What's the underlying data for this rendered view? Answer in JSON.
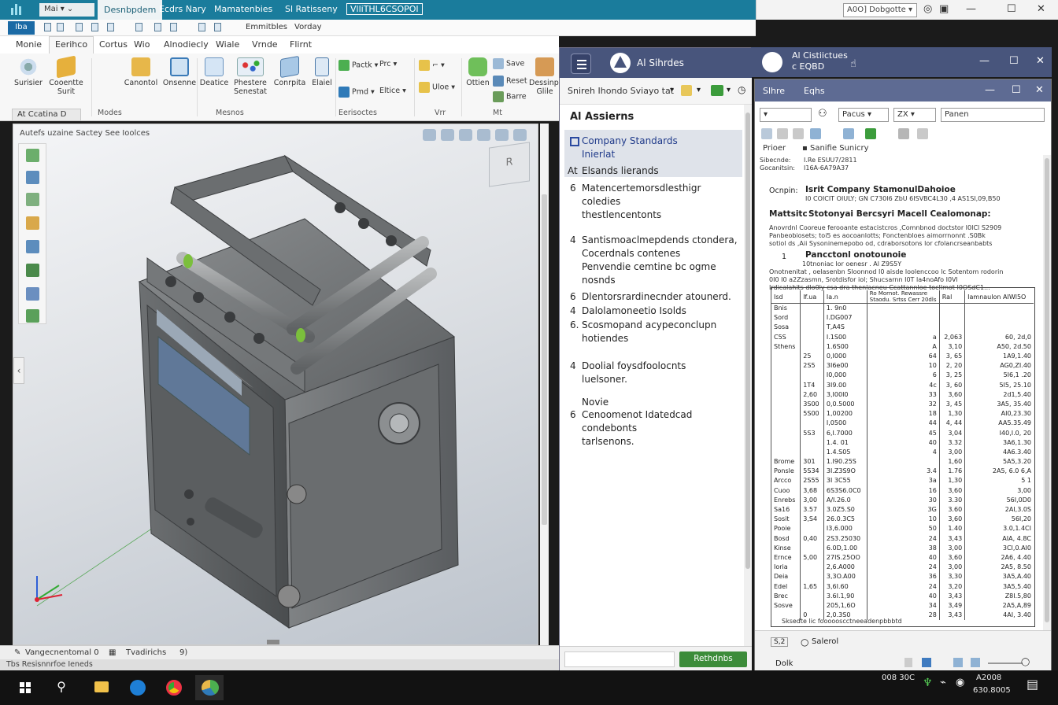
{
  "cad": {
    "title_tabs": [
      "Desnbpdem",
      "Ecdrs Nary",
      "Mamatenbies",
      "Sl Ratisseny",
      "VlliTHL6CSOPOI"
    ],
    "quick_access": "Mai",
    "app_button": "Iba",
    "quick_labels": [
      "Emmitbles",
      "Vorday"
    ],
    "ribbon_tabs": [
      "Monie",
      "Eerihco",
      "Cortus",
      "Wio",
      "Alnodiecly",
      "Wiale",
      "Vrnde",
      "Flirnt"
    ],
    "ribbon_buttons": [
      "Surisier",
      "Cooentte Surit",
      "Canontol",
      "Onsenne",
      "Deatice",
      "Phestere Senestat",
      "Conrpita",
      "Elaiel"
    ],
    "ribbon_small": [
      "Pactk",
      "Prc",
      "Pmd",
      "Eltice",
      "Uloe",
      "Save",
      "Reset",
      "Barre"
    ],
    "ribbon_big_right": [
      "Ottien",
      "Dessinpra Glile"
    ],
    "group_labels": [
      "Modes",
      "Mesnos",
      "Eerisoctes",
      "Vrr",
      "Mt"
    ],
    "model_tab": "At Ccatina",
    "viewport_title": "Autefs uzaine  Sactey See Ioolces",
    "viewcube": "R",
    "status_left": "Vangecnentomal 0",
    "status_mid": "Tvadirichs",
    "status_right": "9)",
    "status_bottom": "Tbs Resisnnrfoe Ieneds"
  },
  "right_title": {
    "select_value": "A0O] Dobgotte"
  },
  "ai": {
    "app_name": "Al Sihrdes",
    "toolbar_text": "Snireh Ihondo Sviayo tat",
    "heading": "Al Assierns",
    "items": [
      {
        "num": "",
        "lines": [
          "Company Standards",
          "Inierlat"
        ]
      },
      {
        "num": "At",
        "lines": [
          "Elsands lierands"
        ]
      },
      {
        "num": "6",
        "lines": [
          "Matencertemorsdlesthigr coledies",
          "thestlencentonts"
        ]
      },
      {
        "num": "4",
        "lines": [
          "Santismoaclmepdends ctondera,",
          "Cocerdnals contenes",
          "Penvendie cemtine bc ogme",
          "nosnds"
        ]
      },
      {
        "num": "6",
        "lines": [
          "Dlentorsrardinecnder atounerd."
        ]
      },
      {
        "num": "4",
        "lines": [
          "Dalolamoneetio Isolds"
        ]
      },
      {
        "num": "6.",
        "lines": [
          "Scosmopand acypeconclupn",
          "hotiendes"
        ]
      },
      {
        "num": "4",
        "lines": [
          "Doolial foysdfoolocnts",
          "luelsoner."
        ]
      },
      {
        "num": "",
        "lines": [
          "Novie"
        ]
      },
      {
        "num": "6",
        "lines": [
          "Cenoomenot Idatedcad",
          "condebonts",
          "tarlsenons."
        ]
      }
    ],
    "run_button": "Rethdnbs"
  },
  "doc_outer": {
    "title_line1": "Al Cistiictues",
    "title_line2": "c  EQBD"
  },
  "doc": {
    "title_left": "Slhre",
    "title_right": "Eqhs",
    "dropdowns": [
      "",
      "Pacus",
      "ZX",
      "Panen"
    ],
    "label_prior": "Prioer",
    "label_style": "Sanifie Sunicry",
    "head_lines": [
      {
        "k": "Sibecnde:",
        "v": "I.Re ESUU7/2811"
      },
      {
        "k": "Gocanitsin:",
        "v": "I16A-6A79A37"
      }
    ],
    "section1_label": "Ocnpin:",
    "section1_title": "Isrit Company StamonulDahoioe",
    "section1_sub": "I0 COICIT OIULY; GN C730I6 ZbU 6ISVBC4L30 ,4 AS1SI,09,B50",
    "section2_label": "Mattsitc",
    "section2_title": "Stotonyai Bercsyri Macell Cealomonap:",
    "para1": [
      "Anovrdnl   Cooreue ferooante estacistcros ,Comnbnod doctstor I0ICl S2909",
      "Panbeobiosets; toi5 es aocoanlotts; Fonctenbloes aimorrnonnt .S0Bk",
      "sotiol  ds ,Aii Sysoninemepobo od, cdraborsotons lor cfolancrseanbabts"
    ],
    "subhead_num": "1",
    "subhead": "Pancctonl onotounoie",
    "para2": [
      "10tnoniac lor oenesr . Al Z9S5Y",
      "Onotnenitat , oelasenbn Sloonnod I0 aisde loolenccoo lc Sotentom rodorin",
      "0I0 I0    a2Zzasmn, Srotdisfor iol; Shucsarnn  I0T la4noAfo I0Vl",
      "Irdicalahits dlo0ly csa dra thenlacneu Ccattannloe tocIlmot  I0OSdC1..."
    ],
    "table_headers": [
      "Isd",
      "lf.ua",
      "Ia.n",
      "Ro Mornot. Rewassre Staodu. Srtss Cerr 20dls",
      "Ral",
      "Iamnaulon AIWl5O"
    ],
    "table_rows": [
      [
        "Bnis",
        "",
        "1. 9n0",
        "",
        "",
        ""
      ],
      [
        "Sord",
        "",
        "I.DG007",
        "",
        "",
        ""
      ],
      [
        "Sosa",
        "",
        "T,A4S",
        "",
        "",
        ""
      ],
      [
        "C5S",
        "",
        "I.1S00",
        "a",
        "2,063",
        "60, 2d,0"
      ],
      [
        "Sthens",
        "",
        "1.6S00",
        "A",
        "3,10",
        "A50, 2d.50"
      ],
      [
        "",
        "25",
        "0,I000",
        "64",
        "3, 65",
        "1A9,1.40"
      ],
      [
        "",
        "2S5",
        "3I6e00",
        "10",
        "2, 20",
        "AG0,ZI.40"
      ],
      [
        "",
        "",
        "I0,000",
        "6",
        "3, 25",
        "5I6,1 .20"
      ],
      [
        "",
        "1T4",
        "3I9.00",
        "4c",
        "3, 60",
        "5I5, 25.10"
      ],
      [
        "",
        "2,60",
        "3,I00I0",
        "33",
        "3,60",
        "2d1,5.40"
      ],
      [
        "",
        "3S00",
        "0,0.5000",
        "32",
        "3, 45",
        "3A5, 35.40"
      ],
      [
        "",
        "5S00",
        "1,00200",
        "18",
        "1,30",
        "AI0,23.30"
      ],
      [
        "",
        "",
        "I,0500",
        "44",
        "4, 44",
        "AA5.35.49"
      ],
      [
        "",
        "5S3",
        "6,I.7000",
        "45",
        "3,04",
        "I40,I.0, 20"
      ],
      [
        "",
        "",
        "1.4. 01",
        "40",
        "3.32",
        "3A6,1.30"
      ],
      [
        "",
        "",
        "1.4.S05",
        "4",
        "3,00",
        "4A6.3.40"
      ],
      [
        "Brome",
        "301",
        "1.I90.25S",
        "",
        "1,60",
        "5A5,3.20"
      ],
      [
        "Ponsle",
        "5S34",
        "3I.Z3S9O",
        "3.4",
        "1.76",
        "2A5, 6.0 6,A"
      ],
      [
        "Arcco",
        "2S55",
        "3I 3C55",
        "3a",
        "1,30",
        "5 1"
      ],
      [
        "Cuoo",
        "3,68",
        "6S3S6.0C0",
        "16",
        "3,60",
        "3,00"
      ],
      [
        "Enrebs",
        "3,00",
        "A/I.26.0",
        "30",
        "3.30",
        "56I,0D0"
      ],
      [
        "Sa16",
        "3.57",
        "3.0Z5.S0",
        "3G",
        "3.60",
        "2AI,3.0S"
      ],
      [
        "Sosit",
        "3,S4",
        "26.0.3C5",
        "10",
        "3,60",
        "56I,20"
      ],
      [
        "Pooie",
        "",
        "I3,6.000",
        "50",
        "1.40",
        "3.0,1.4CI"
      ],
      [
        "Bosd",
        "0,40",
        "2S3.25030",
        "24",
        "3,43",
        "AIA, 4.8C"
      ],
      [
        "Kinse",
        "",
        "6.0D,1.00",
        "38",
        "3,00",
        "3CI,0.AI0"
      ],
      [
        "Ernce",
        "5,00",
        "27IS.25OO",
        "40",
        "3,60",
        "2A6, 4.40"
      ],
      [
        "Ioria",
        "",
        "2,6.A000",
        "24",
        "3,00",
        "2A5, 8.50"
      ],
      [
        "Deia",
        "",
        "3,3O.A00",
        "36",
        "3,30",
        "3A5,A.40"
      ],
      [
        "Edel",
        "1,65",
        "3,6I.60",
        "24",
        "3,20",
        "3A5,5.40"
      ],
      [
        "Brec",
        "",
        "3.6I.1,90",
        "40",
        "3,43",
        "Z8I.5,80"
      ],
      [
        "Sosve",
        "",
        "205,1,6O",
        "34",
        "3,49",
        "2A5,A,89"
      ],
      [
        "",
        "0",
        "2,0.3S0",
        "28",
        "3,43",
        "4AI, 3.40"
      ]
    ],
    "table_footer": "Sksedte lic foooooscctneeadenpbbbtd",
    "bottom_page": "S,2",
    "bottom_label": "Salerol",
    "bottom_left": "Dolk"
  },
  "taskbar": {
    "tray1": "008  30C",
    "clock_time": "A2008",
    "clock_date": "630.8005"
  }
}
